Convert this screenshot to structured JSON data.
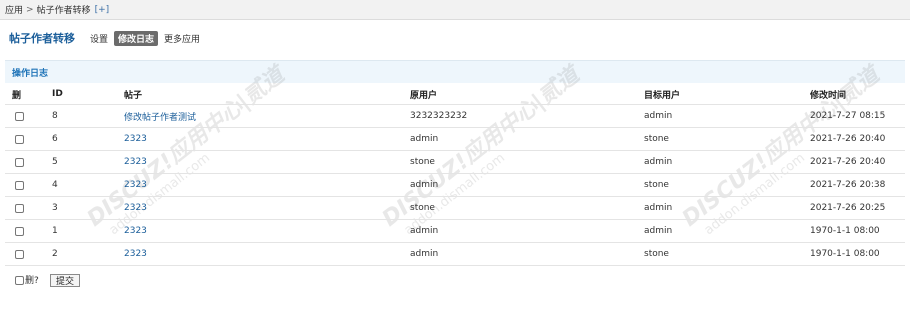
{
  "breadcrumb": {
    "root": "应用",
    "separator": ">",
    "current": "帖子作者转移",
    "add": "[+]"
  },
  "header": {
    "title": "帖子作者转移",
    "tabs": [
      {
        "label": "设置"
      },
      {
        "label": "修改日志"
      },
      {
        "label": "更多应用"
      }
    ]
  },
  "section": {
    "title": "操作日志"
  },
  "watermark": {
    "text": "DISCUZ!应用中心|贰道",
    "url": "addon.dismall.com"
  },
  "table": {
    "columns": [
      "删",
      "ID",
      "帖子",
      "原用户",
      "目标用户",
      "修改时间"
    ],
    "rows": [
      {
        "id": "8",
        "thread": "修改帖子作者测试",
        "from_user": "3232323232",
        "to_user": "admin",
        "time": "2021-7-27 08:15"
      },
      {
        "id": "6",
        "thread": "2323",
        "from_user": "admin",
        "to_user": "stone",
        "time": "2021-7-26 20:40"
      },
      {
        "id": "5",
        "thread": "2323",
        "from_user": "stone",
        "to_user": "admin",
        "time": "2021-7-26 20:40"
      },
      {
        "id": "4",
        "thread": "2323",
        "from_user": "admin",
        "to_user": "stone",
        "time": "2021-7-26 20:38"
      },
      {
        "id": "3",
        "thread": "2323",
        "from_user": "stone",
        "to_user": "admin",
        "time": "2021-7-26 20:25"
      },
      {
        "id": "1",
        "thread": "2323",
        "from_user": "admin",
        "to_user": "admin",
        "time": "1970-1-1 08:00"
      },
      {
        "id": "2",
        "thread": "2323",
        "from_user": "admin",
        "to_user": "stone",
        "time": "1970-1-1 08:00"
      }
    ]
  },
  "footer": {
    "delete_label": "删?",
    "submit_label": "提交"
  }
}
